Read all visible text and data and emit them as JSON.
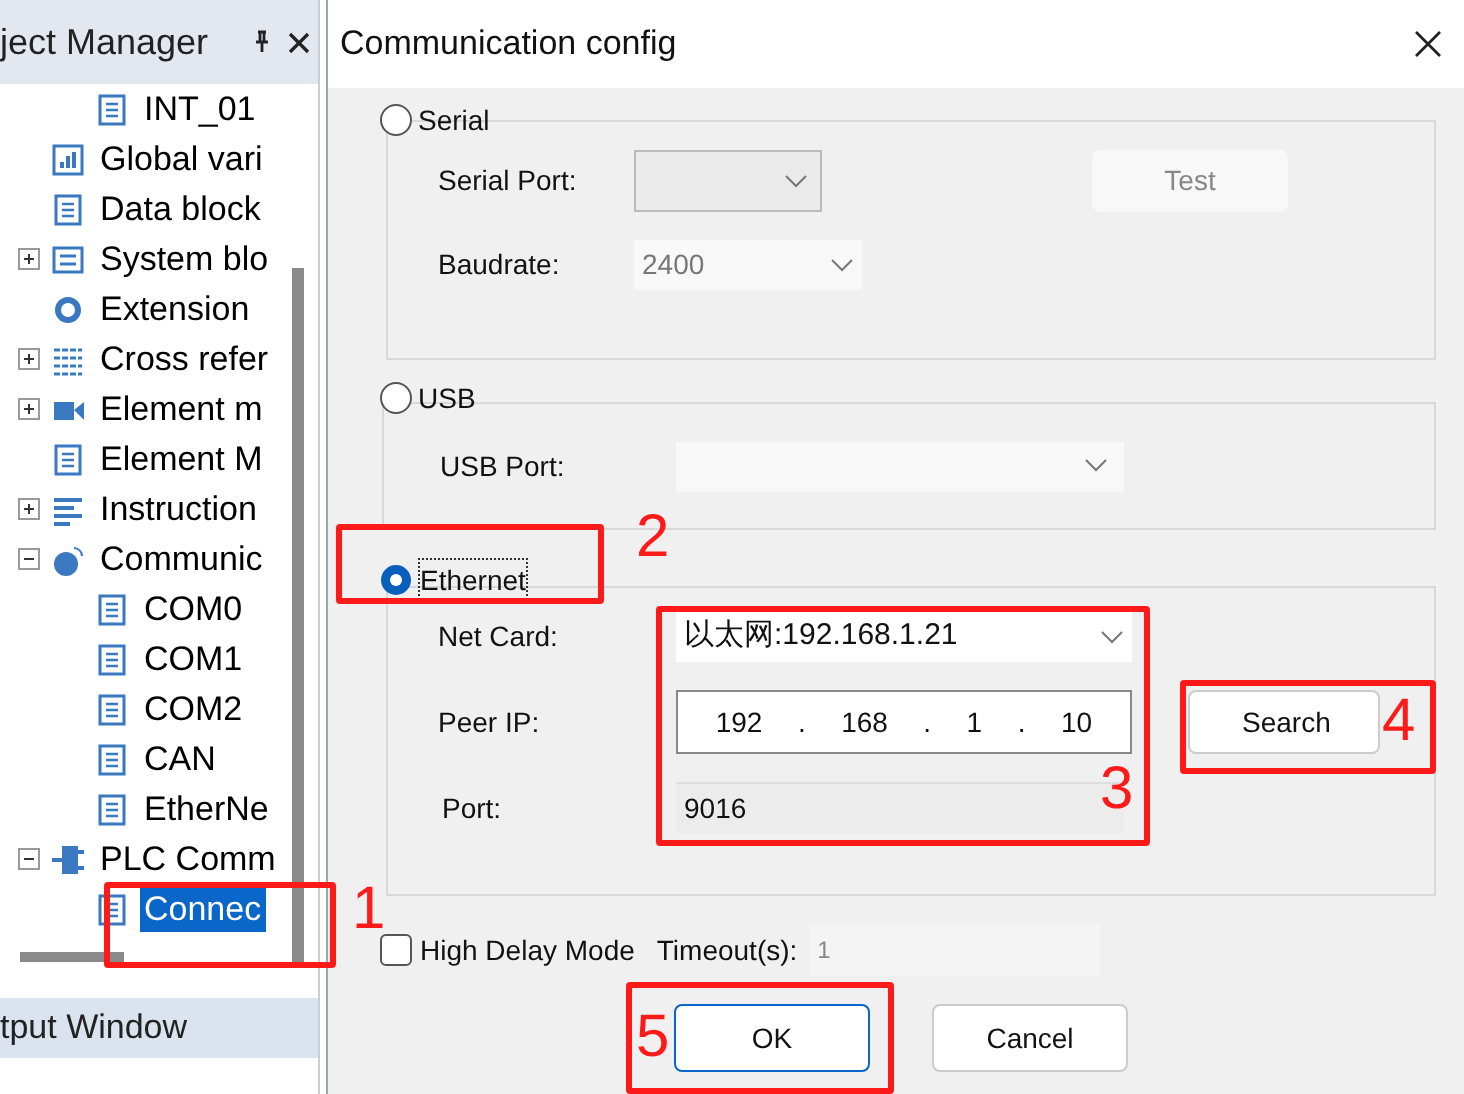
{
  "project_panel": {
    "title": "ject Manager",
    "tree": [
      {
        "children": [
          {
            "label": "INT_01"
          }
        ]
      },
      {
        "label": "Global vari"
      },
      {
        "label": "Data block"
      },
      {
        "label": "System blo",
        "expanded": false
      },
      {
        "label": "Extension"
      },
      {
        "label": "Cross refer",
        "expanded": false
      },
      {
        "label": "Element m",
        "expanded": false
      },
      {
        "label": "Element M"
      },
      {
        "label": "Instruction",
        "expanded": false
      },
      {
        "label": "Communic",
        "expanded": true,
        "children": [
          {
            "label": "COM0"
          },
          {
            "label": "COM1"
          },
          {
            "label": "COM2"
          },
          {
            "label": "CAN"
          },
          {
            "label": "EtherNe"
          }
        ]
      },
      {
        "label": "PLC Comm",
        "expanded": true,
        "children": [
          {
            "label": "Connec",
            "selected": true
          }
        ]
      }
    ],
    "footer": "tput Window"
  },
  "dialog": {
    "title": "Communication config",
    "serial": {
      "label": "Serial",
      "selected": false,
      "port_label": "Serial Port:",
      "baud_label": "Baudrate:",
      "baud_value": "2400",
      "test_button": "Test"
    },
    "usb": {
      "label": "USB",
      "selected": false,
      "port_label": "USB Port:"
    },
    "ethernet": {
      "label": "Ethernet",
      "selected": true,
      "netcard_label": "Net Card:",
      "netcard_value": "以太网:192.168.1.21",
      "peer_label": "Peer IP:",
      "peer_ip": [
        {
          "octet": "192",
          "separator": "."
        },
        {
          "octet": "168",
          "separator": "."
        },
        {
          "octet": "1",
          "separator": "."
        },
        {
          "octet": "10"
        }
      ],
      "port_label": "Port:",
      "port_value": "9016",
      "search_button": "Search"
    },
    "high_delay": {
      "label": "High Delay Mode",
      "checked": false
    },
    "timeout": {
      "label": "Timeout(s):",
      "value": "1"
    },
    "buttons": [
      {
        "label": "OK",
        "default": true
      },
      {
        "label": "Cancel",
        "default": false
      }
    ]
  },
  "annotations": [
    {
      "number": "1"
    },
    {
      "number": "2"
    },
    {
      "number": "3"
    },
    {
      "number": "4"
    },
    {
      "number": "5"
    }
  ]
}
